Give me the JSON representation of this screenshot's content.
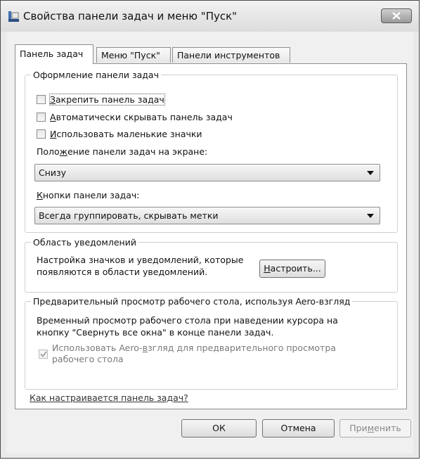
{
  "window": {
    "title": "Свойства панели задач и меню \"Пуск\"",
    "icons": {
      "app": "taskbar-icon",
      "close": "close-icon"
    }
  },
  "tabs": [
    {
      "label": "Панель задач",
      "active": true
    },
    {
      "label": "Меню \"Пуск\"",
      "active": false
    },
    {
      "label": "Панели инструментов",
      "active": false
    }
  ],
  "taskbar_group": {
    "title": "Оформление панели задач",
    "lock": {
      "pre": "",
      "key": "З",
      "post": "акрепить панель задач",
      "checked": false
    },
    "autohide": {
      "pre": "",
      "key": "А",
      "post": "втоматически скрывать панель задач",
      "checked": false
    },
    "small_icons": {
      "pre": "",
      "key": "И",
      "post": "спользовать маленькие значки",
      "checked": false
    },
    "position_label": {
      "pre": "Поло",
      "key": "ж",
      "post": "ение панели задач на экране:"
    },
    "position_value": "Снизу",
    "buttons_label": {
      "pre": "",
      "key": "К",
      "post": "нопки панели задач:"
    },
    "buttons_value": "Всегда группировать, скрывать метки"
  },
  "notify_group": {
    "title": "Область уведомлений",
    "description": [
      "Настройка значков и уведомлений, которые",
      "появляются в области уведомлений."
    ],
    "customize": {
      "pre": "",
      "key": "Н",
      "post": "астроить..."
    }
  },
  "peek_group": {
    "title": "Предварительный просмотр рабочего стола, используя Aero-взгляд",
    "description": [
      "Временный просмотр рабочего стола при наведении курсора на",
      "кнопку \"Свернуть все окна\" в конце панели задач."
    ],
    "use_peek": {
      "pre": "Использовать Aero-",
      "key": "в",
      "post": "згляд для предварительного просмотра",
      "line2": "рабочего стола",
      "checked": true,
      "enabled": false
    }
  },
  "help_link": "Как настраивается панель задач?",
  "footer": {
    "ok": "ОК",
    "cancel": "Отмена",
    "apply": {
      "pre": "При",
      "key": "м",
      "post": "енить",
      "enabled": false
    }
  }
}
